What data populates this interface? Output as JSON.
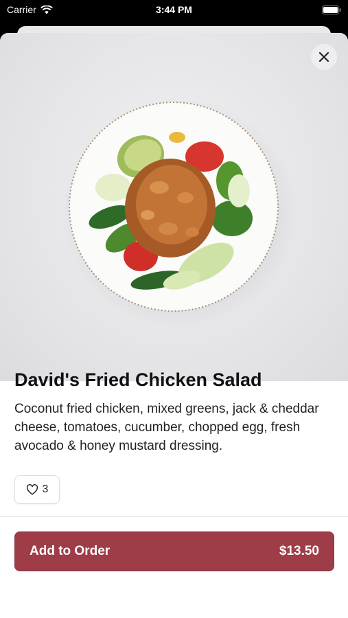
{
  "status_bar": {
    "carrier": "Carrier",
    "time": "3:44 PM"
  },
  "item": {
    "title": "David's Fried Chicken Salad",
    "description": "Coconut fried chicken, mixed greens, jack & cheddar cheese, tomatoes, cucumber, chopped egg, fresh avocado & honey mustard dressing.",
    "like_count": "3"
  },
  "order_button": {
    "label": "Add to Order",
    "price": "$13.50"
  },
  "colors": {
    "accent": "#9e3d48"
  },
  "icons": [
    "wifi-icon",
    "battery-icon",
    "close-icon",
    "heart-icon"
  ]
}
